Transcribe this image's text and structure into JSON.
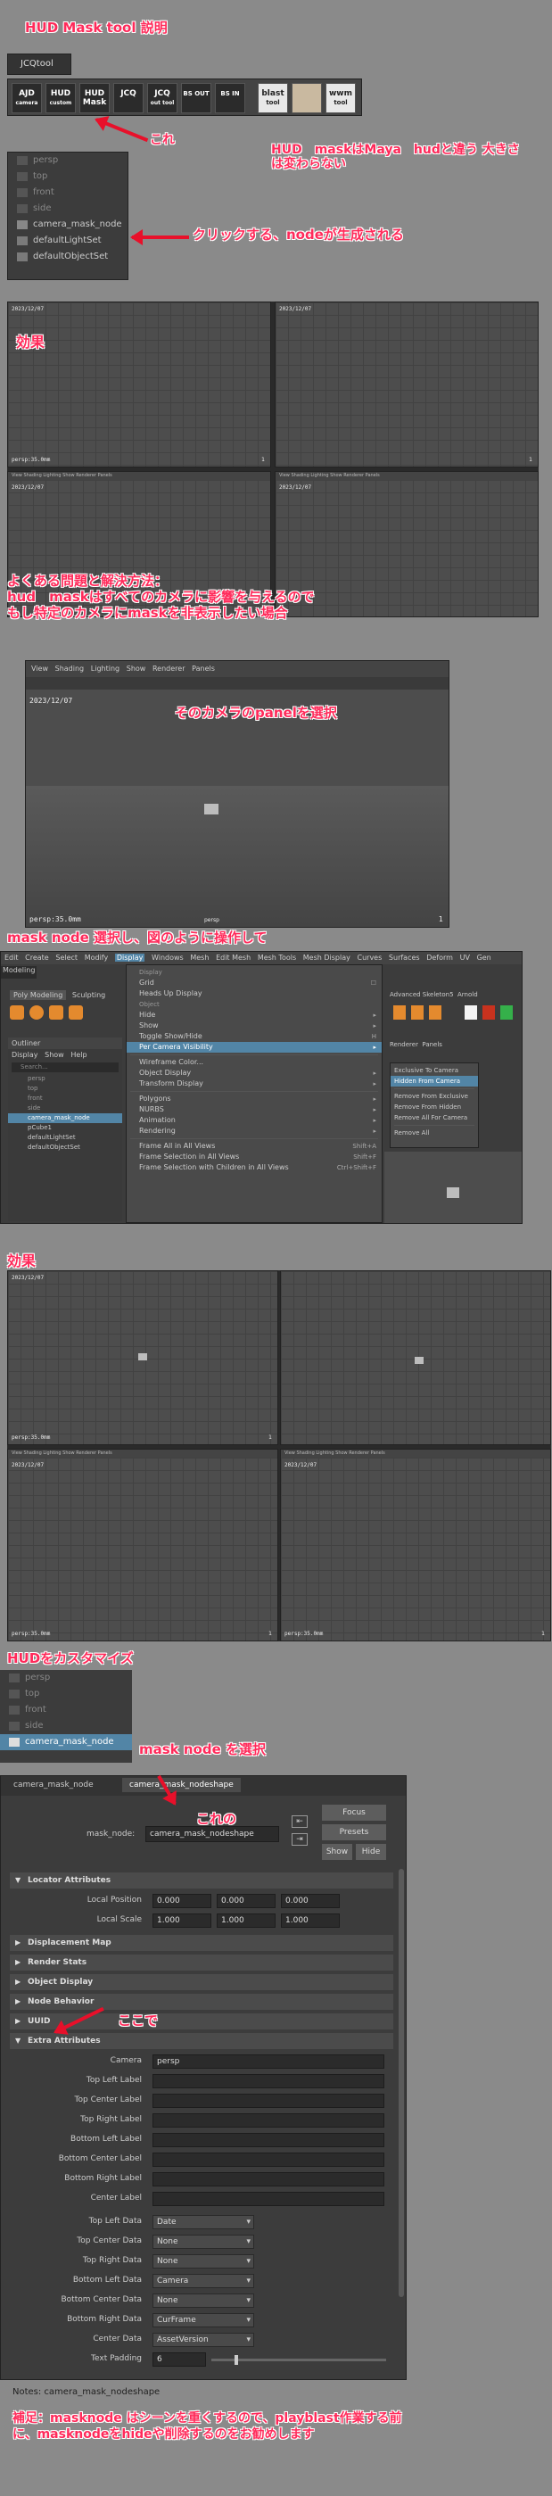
{
  "title": "HUD  Mask tool 説明",
  "shelf": {
    "tab": "JCQtool",
    "buttons": [
      {
        "label": "AJD",
        "sub": "camera"
      },
      {
        "label": "HUD",
        "sub": "custom"
      },
      {
        "label": "HUD",
        "sub": "Mask"
      },
      {
        "label": "JCQ",
        "sub": ""
      },
      {
        "label": "JCQ",
        "sub": "out tool"
      },
      {
        "label": "BS OUT",
        "sub": ""
      },
      {
        "label": "BS IN",
        "sub": ""
      },
      {
        "label": "blast",
        "sub": "tool"
      },
      {
        "label": "",
        "sub": ""
      },
      {
        "label": "wwm",
        "sub": "tool"
      }
    ]
  },
  "annotations": {
    "kore1": "これ",
    "note_size": "HUD　maskはMaya　hudと違う 大きさは変わらない",
    "click_node": "クリックする、nodeが生成される",
    "effect1": "効果",
    "faq": "よくある問題と解決方法：\nhud　maskはすべてのカメラに影響を与えるので\nもし特定のカメラにmaskを非表示したい場合",
    "select_panel": "そのカメラのpanelを選択",
    "mask_select": "mask node 選択し、図のように操作して",
    "effect2": "効果",
    "customize": "HUDをカスタマイズ",
    "select_mask": "mask node を選択",
    "kore2": "これの",
    "koko": "ここで",
    "supplement": "補足：masknode はシーンを重くするので、playblast作業する前に、masknodeをhideや削除するのをお勧めします"
  },
  "outliner1": {
    "items": [
      "persp",
      "top",
      "front",
      "side",
      "camera_mask_node",
      "defaultLightSet",
      "defaultObjectSet"
    ]
  },
  "viewports": {
    "date": "2023/12/07",
    "cam": "persp:35.0mm",
    "num": "1",
    "menubar": "View  Shading  Lighting  Show  Renderer  Panels"
  },
  "panel_view": {
    "menu": [
      "View",
      "Shading",
      "Lighting",
      "Show",
      "Renderer",
      "Panels"
    ],
    "date": "2023/12/07",
    "cam": "persp:35.0mm",
    "num": "1",
    "bottom": "persp"
  },
  "maya_ui": {
    "menubar": [
      "Edit",
      "Create",
      "Select",
      "Modify",
      "Display",
      "Windows",
      "Mesh",
      "Edit Mesh",
      "Mesh Tools",
      "Mesh Display",
      "Curves",
      "Surfaces",
      "Deform",
      "UV",
      "Gen"
    ],
    "left_mode": "Modeling",
    "shelf_tabs": [
      "Poly Modeling",
      "Sculpting"
    ],
    "right_tabs": [
      "Advanced Skeleton5",
      "Arnold"
    ],
    "outliner_title": "Outliner",
    "outliner_menu": [
      "Display",
      "Show",
      "Help"
    ],
    "search": "Search...",
    "outliner_items": [
      "persp",
      "top",
      "front",
      "side",
      "camera_mask_node",
      "pCube1",
      "defaultLightSet",
      "defaultObjectSet"
    ],
    "display_menu_title": "Display",
    "display_menu": [
      {
        "label": "Grid",
        "sc": ""
      },
      {
        "label": "Heads Up Display",
        "sc": ""
      },
      {
        "label": "Object",
        "sc": ""
      },
      {
        "label": "Hide",
        "sc": "▸"
      },
      {
        "label": "Show",
        "sc": "▸"
      },
      {
        "label": "Toggle Show/Hide",
        "sc": "H"
      },
      {
        "label": "Per Camera Visibility",
        "sc": "▸"
      },
      {
        "label": "Wireframe Color...",
        "sc": ""
      },
      {
        "label": "Object Display",
        "sc": "▸"
      },
      {
        "label": "Transform Display",
        "sc": "▸"
      },
      {
        "label": "Polygons",
        "sc": "▸"
      },
      {
        "label": "NURBS",
        "sc": "▸"
      },
      {
        "label": "Animation",
        "sc": "▸"
      },
      {
        "label": "Rendering",
        "sc": "▸"
      },
      {
        "label": "Frame All in All Views",
        "sc": "Shift+A"
      },
      {
        "label": "Frame Selection in All Views",
        "sc": "Shift+F"
      },
      {
        "label": "Frame Selection with Children in All Views",
        "sc": "Ctrl+Shift+F"
      }
    ],
    "submenu": [
      "Exclusive To Camera",
      "Hidden From Camera",
      "Remove From Exclusive",
      "Remove From Hidden",
      "Remove All For Camera",
      "Remove All"
    ],
    "panel_menu": [
      "Renderer",
      "Panels"
    ]
  },
  "outliner2": {
    "items": [
      "persp",
      "top",
      "front",
      "side",
      "camera_mask_node"
    ]
  },
  "attr_editor": {
    "tabs": [
      "camera_mask_node",
      "camera_mask_nodeshape"
    ],
    "node_label": "mask_node:",
    "node_value": "camera_mask_nodeshape",
    "focus": "Focus",
    "presets": "Presets",
    "show": "Show",
    "hide": "Hide",
    "locator_section": "Locator Attributes",
    "local_position_label": "Local Position",
    "local_position": [
      "0.000",
      "0.000",
      "0.000"
    ],
    "local_scale_label": "Local Scale",
    "local_scale": [
      "1.000",
      "1.000",
      "1.000"
    ],
    "sections": [
      "Displacement Map",
      "Render Stats",
      "Object Display",
      "Node Behavior",
      "UUID"
    ],
    "extra_section": "Extra Attributes",
    "text_rows": [
      {
        "label": "Camera",
        "value": "persp"
      },
      {
        "label": "Top Left Label",
        "value": ""
      },
      {
        "label": "Top Center Label",
        "value": ""
      },
      {
        "label": "Top Right Label",
        "value": ""
      },
      {
        "label": "Bottom Left Label",
        "value": ""
      },
      {
        "label": "Bottom Center Label",
        "value": ""
      },
      {
        "label": "Bottom Right Label",
        "value": ""
      },
      {
        "label": "Center Label",
        "value": ""
      }
    ],
    "data_rows": [
      {
        "label": "Top Left Data",
        "value": "Date"
      },
      {
        "label": "Top Center Data",
        "value": "None"
      },
      {
        "label": "Top Right Data",
        "value": "None"
      },
      {
        "label": "Bottom Left Data",
        "value": "Camera"
      },
      {
        "label": "Bottom Center Data",
        "value": "None"
      },
      {
        "label": "Bottom Right Data",
        "value": "CurFrame"
      },
      {
        "label": "Center Data",
        "value": "AssetVersion"
      }
    ],
    "padding_label": "Text Padding",
    "padding_value": "6",
    "notes": "Notes: camera_mask_nodeshape"
  },
  "colors": {
    "accent_pink": "#ff2a5a",
    "arrow_red": "#e8102a",
    "maya_bg": "#3c3c3c",
    "highlight": "#5285a6"
  }
}
